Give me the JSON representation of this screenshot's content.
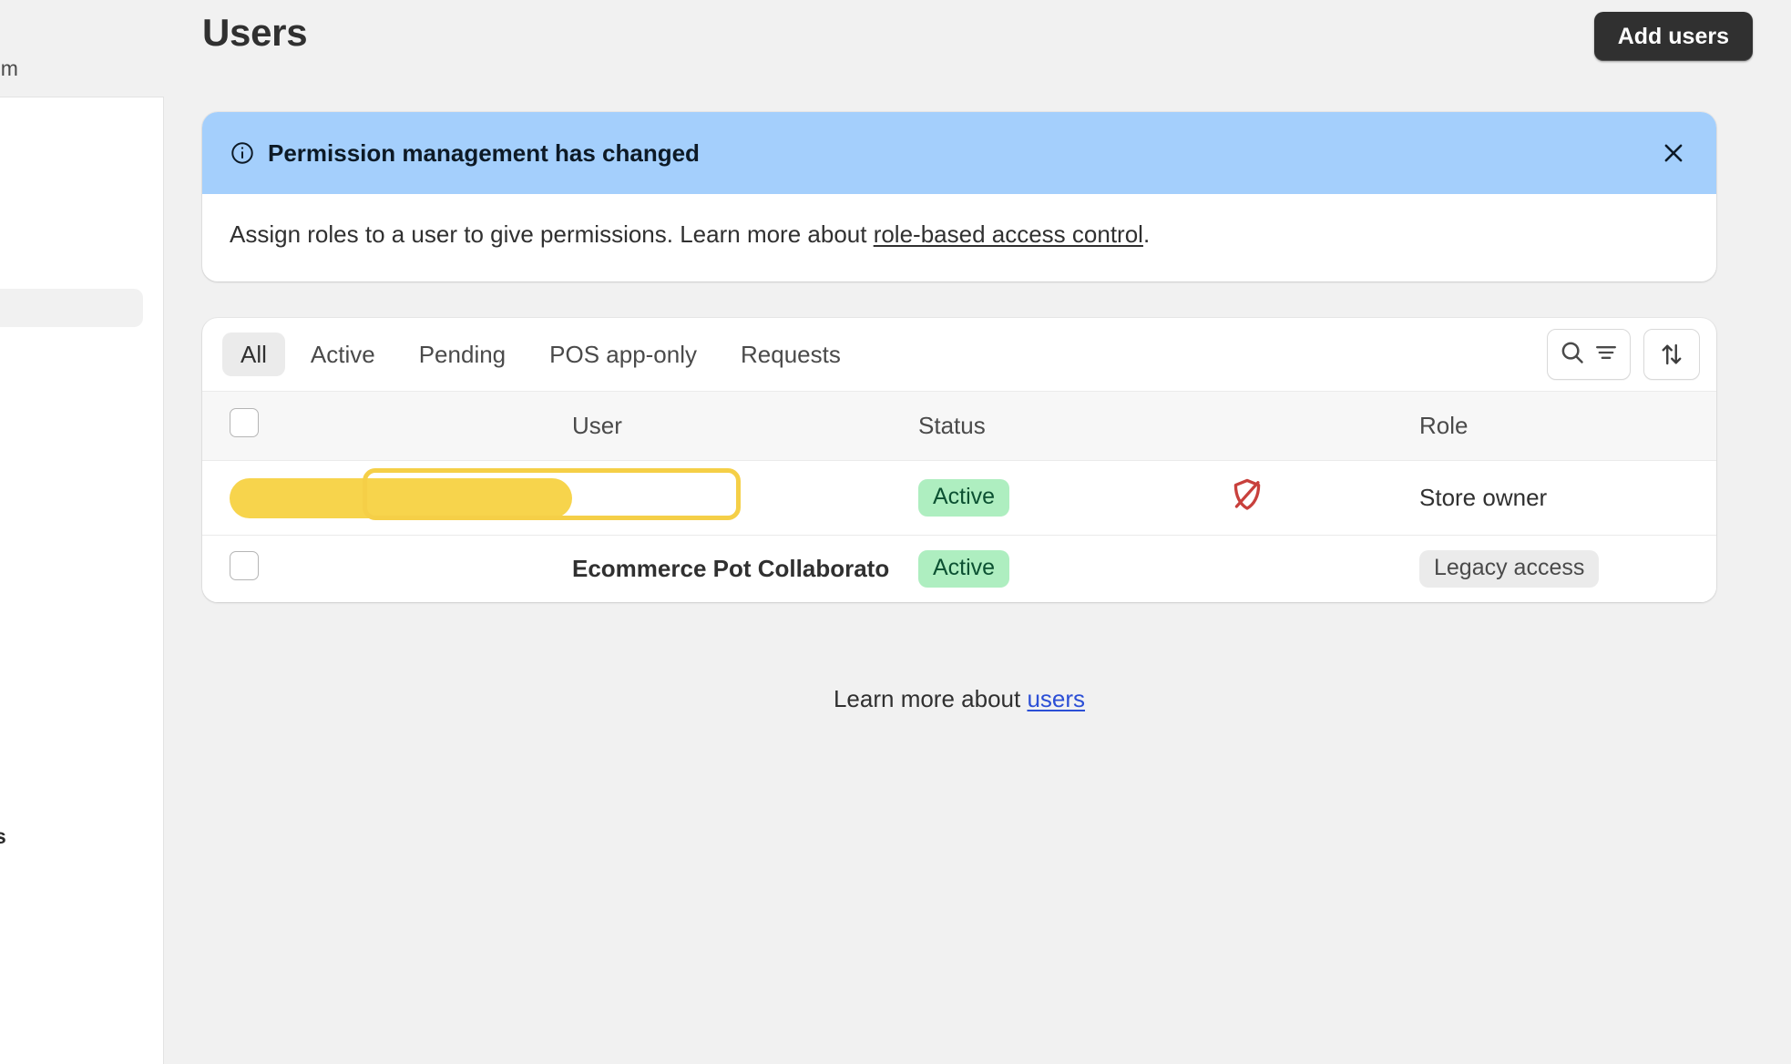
{
  "sidebar": {
    "domain_fragment": "om",
    "bottom_fragment": "s"
  },
  "header": {
    "title": "Users",
    "add_users_label": "Add users"
  },
  "banner": {
    "icon": "info-circle-icon",
    "title": "Permission management has changed",
    "close_icon": "close-icon",
    "body_prefix": "Assign roles to a user to give permissions. Learn more about ",
    "body_link": "role-based access control",
    "body_suffix": "."
  },
  "toolbar": {
    "tabs": [
      {
        "label": "All",
        "selected": true
      },
      {
        "label": "Active",
        "selected": false
      },
      {
        "label": "Pending",
        "selected": false
      },
      {
        "label": "POS app-only",
        "selected": false
      },
      {
        "label": "Requests",
        "selected": false
      }
    ],
    "search_icon": "search-icon",
    "filter_icon": "filter-icon",
    "sort_icon": "sort-arrows-icon"
  },
  "table": {
    "columns": [
      "User",
      "Status",
      "Role"
    ],
    "rows": [
      {
        "user": "",
        "user_redacted": true,
        "status": "Active",
        "flag_icon": "shield-disabled-icon",
        "role": "Store owner",
        "role_is_pill": false
      },
      {
        "user": "Ecommerce Pot Collaborato",
        "user_redacted": false,
        "status": "Active",
        "flag_icon": "",
        "role": "Legacy access",
        "role_is_pill": true
      }
    ]
  },
  "footer": {
    "prefix": "Learn more about ",
    "link": "users"
  },
  "colors": {
    "banner_blue": "#a4cffc",
    "badge_green_bg": "#aeeec0",
    "badge_green_text": "#0c5132",
    "pill_grey_bg": "#ebebeb",
    "redaction_yellow": "#f7d44c",
    "annotation_yellow": "#f5cf47",
    "shield_red": "#c8403c",
    "button_dark": "#303030",
    "link_blue": "#2c4fd6",
    "page_bg": "#f1f1f1"
  }
}
